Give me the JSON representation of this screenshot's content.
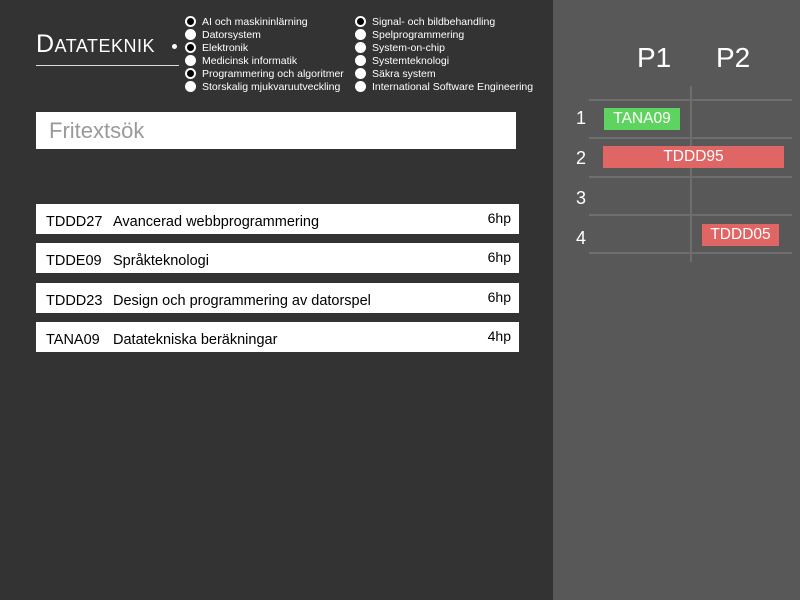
{
  "app": {
    "title": "Datateknik"
  },
  "filters": {
    "col1": [
      {
        "label": "AI och maskininlärning",
        "checked": true
      },
      {
        "label": "Datorsystem",
        "checked": false
      },
      {
        "label": "Elektronik",
        "checked": true
      },
      {
        "label": "Medicinsk informatik",
        "checked": false
      },
      {
        "label": "Programmering och algoritmer",
        "checked": true
      },
      {
        "label": "Storskalig mjukvaruutveckling",
        "checked": false
      }
    ],
    "col2": [
      {
        "label": "Signal- och bildbehandling",
        "checked": true
      },
      {
        "label": "Spelprogrammering",
        "checked": false
      },
      {
        "label": "System-on-chip",
        "checked": false
      },
      {
        "label": "Systemteknologi",
        "checked": false
      },
      {
        "label": "Säkra system",
        "checked": false
      },
      {
        "label": "International Software Engineering",
        "checked": false
      }
    ]
  },
  "search": {
    "placeholder": "Fritextsök",
    "value": ""
  },
  "courses": [
    {
      "code": "TDDD27",
      "name": "Avancerad webbprogrammering",
      "hp": "6hp"
    },
    {
      "code": "TDDE09",
      "name": "Språkteknologi",
      "hp": "6hp"
    },
    {
      "code": "TDDD23",
      "name": "Design och programmering av datorspel",
      "hp": "6hp"
    },
    {
      "code": "TANA09",
      "name": "Datatekniska beräkningar",
      "hp": "4hp"
    }
  ],
  "schedule": {
    "periods": [
      "P1",
      "P2"
    ],
    "rows": [
      "1",
      "2",
      "3",
      "4"
    ],
    "blocks": [
      {
        "label": "TANA09",
        "color": "#5fd35f"
      },
      {
        "label": "TDDD95",
        "color": "#e06666"
      },
      {
        "label": "TDDD05",
        "color": "#e06666"
      }
    ]
  },
  "colors": {
    "background": "#333333",
    "sidebar": "#585858",
    "green": "#5fd35f",
    "red": "#e06666"
  }
}
